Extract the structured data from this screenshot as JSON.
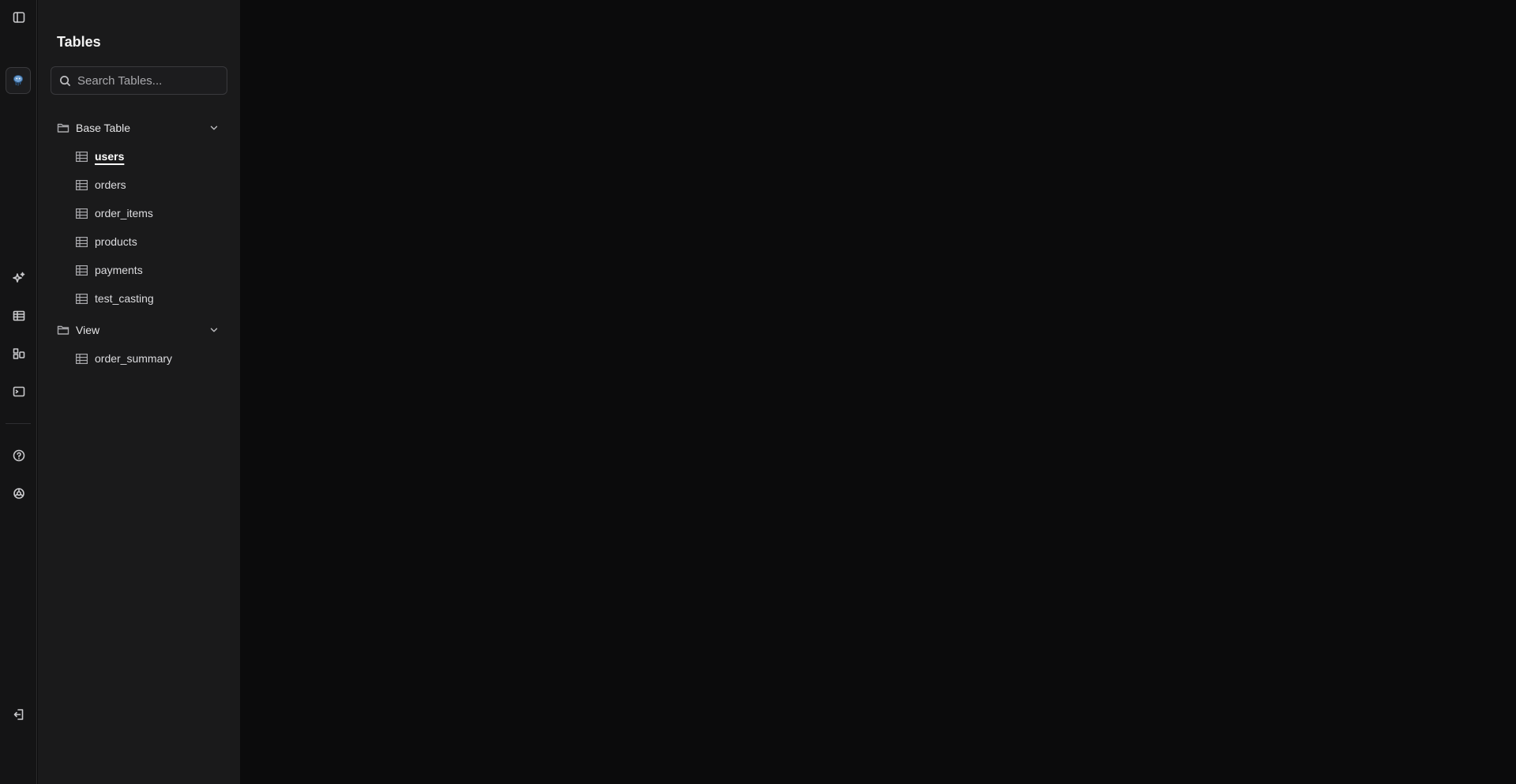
{
  "panel": {
    "title": "Tables",
    "search_placeholder": "Search Tables..."
  },
  "groups": [
    {
      "label": "Base Table",
      "items": [
        "users",
        "orders",
        "order_items",
        "products",
        "payments",
        "test_casting"
      ]
    },
    {
      "label": "View",
      "items": [
        "order_summary"
      ]
    }
  ],
  "active_item": "users",
  "rail": {
    "icons": [
      "sidebar-toggle-icon",
      "postgres-database-icon",
      "sparkles-icon",
      "table-icon",
      "shapes-icon",
      "terminal-icon",
      "help-circle-icon",
      "settings-icon",
      "logout-icon"
    ]
  }
}
